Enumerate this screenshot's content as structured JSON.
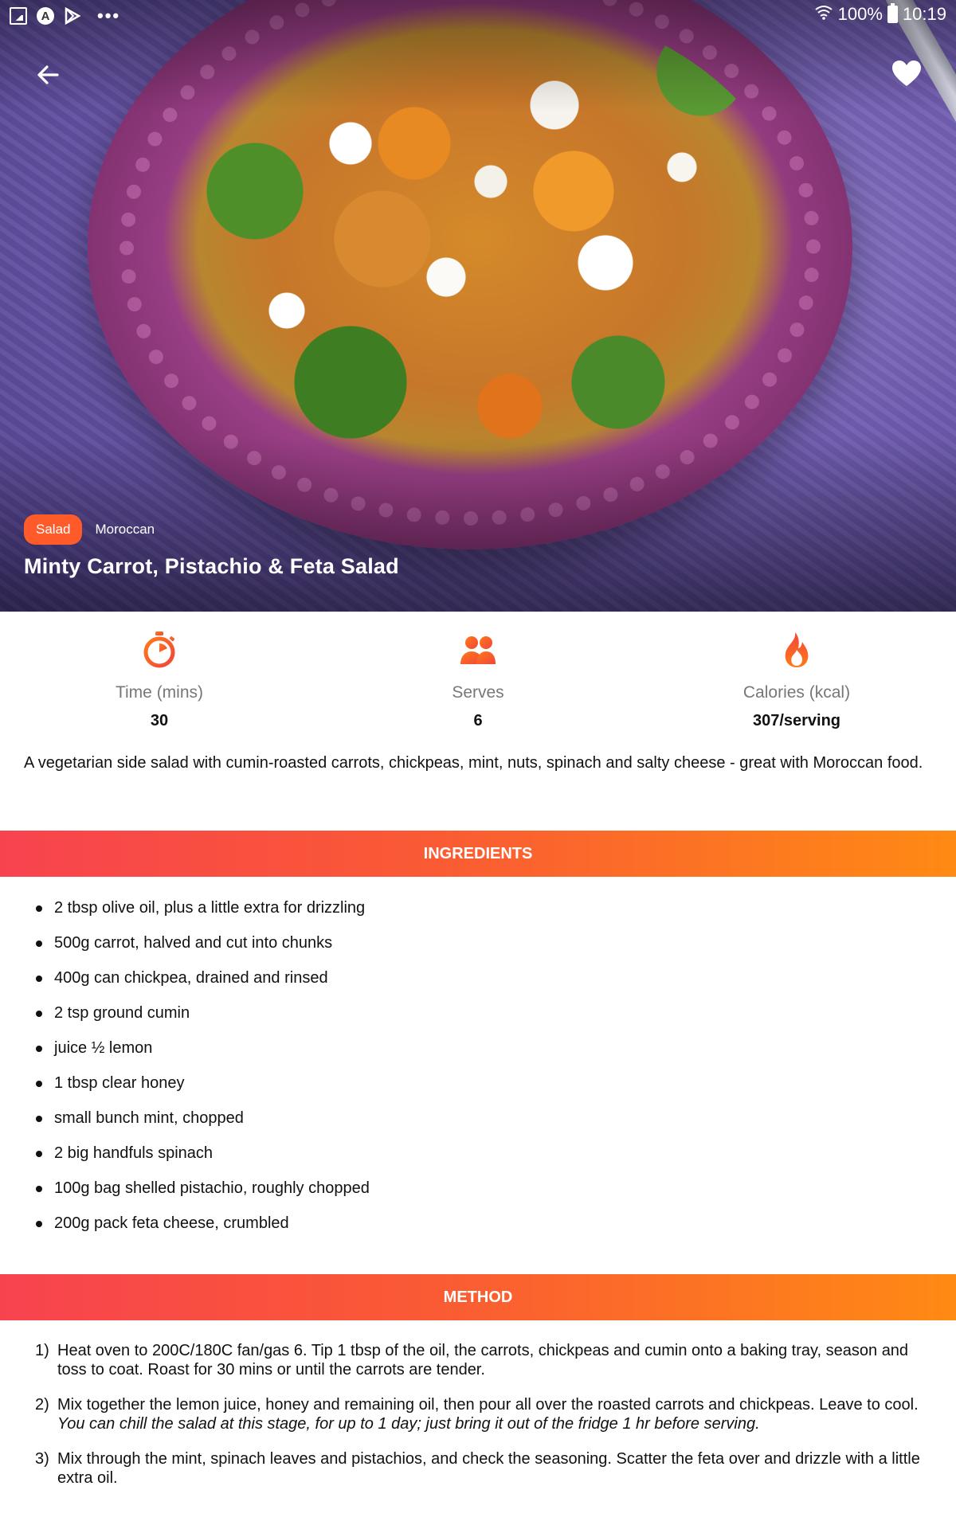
{
  "status_bar": {
    "battery": "100%",
    "time": "10:19",
    "dots": "•••",
    "circle_letter": "A"
  },
  "colors": {
    "accent": "#ff5a2a",
    "banner_gradient": [
      "#f7434f",
      "#fa5a34",
      "#ff8a14"
    ],
    "icon_orange": "#ff6a2a"
  },
  "hero": {
    "tag_category": "Salad",
    "tag_cuisine": "Moroccan",
    "title": "Minty Carrot, Pistachio & Feta Salad",
    "back_icon": "arrow-left-icon",
    "favorite_icon": "heart-icon"
  },
  "stats": [
    {
      "icon": "stopwatch-icon",
      "label": "Time (mins)",
      "value": "30"
    },
    {
      "icon": "people-icon",
      "label": "Serves",
      "value": "6"
    },
    {
      "icon": "flame-icon",
      "label": "Calories (kcal)",
      "value": "307/serving"
    }
  ],
  "description": "A vegetarian side salad with cumin-roasted carrots, chickpeas, mint, nuts, spinach and salty cheese - great with Moroccan food.",
  "ingredients_header": "INGREDIENTS",
  "ingredients": [
    "2 tbsp olive oil, plus a little extra for drizzling",
    "500g carrot, halved and cut into chunks",
    "400g can chickpea, drained and rinsed",
    "2 tsp ground cumin",
    "juice ½ lemon",
    "1 tbsp clear honey",
    "small bunch mint, chopped",
    "2 big handfuls spinach",
    "100g bag shelled pistachio, roughly chopped",
    "200g pack feta cheese, crumbled"
  ],
  "method_header": "METHOD",
  "method": [
    {
      "num": "1)",
      "text": "Heat oven to 200C/180C fan/gas 6. Tip 1 tbsp of the oil, the carrots, chickpeas and cumin onto a baking tray, season and toss to coat. Roast for 30 mins or until the carrots are tender.",
      "note": ""
    },
    {
      "num": "2)",
      "text": "Mix together the lemon juice, honey and remaining oil, then pour all over the roasted carrots and chickpeas. Leave to cool. ",
      "note": "You can chill the salad at this stage, for up to 1 day; just bring it out of the fridge 1 hr before serving."
    },
    {
      "num": "3)",
      "text": "Mix through the mint, spinach leaves and pistachios, and check the seasoning. Scatter the feta over and drizzle with a little extra oil.",
      "note": ""
    }
  ]
}
